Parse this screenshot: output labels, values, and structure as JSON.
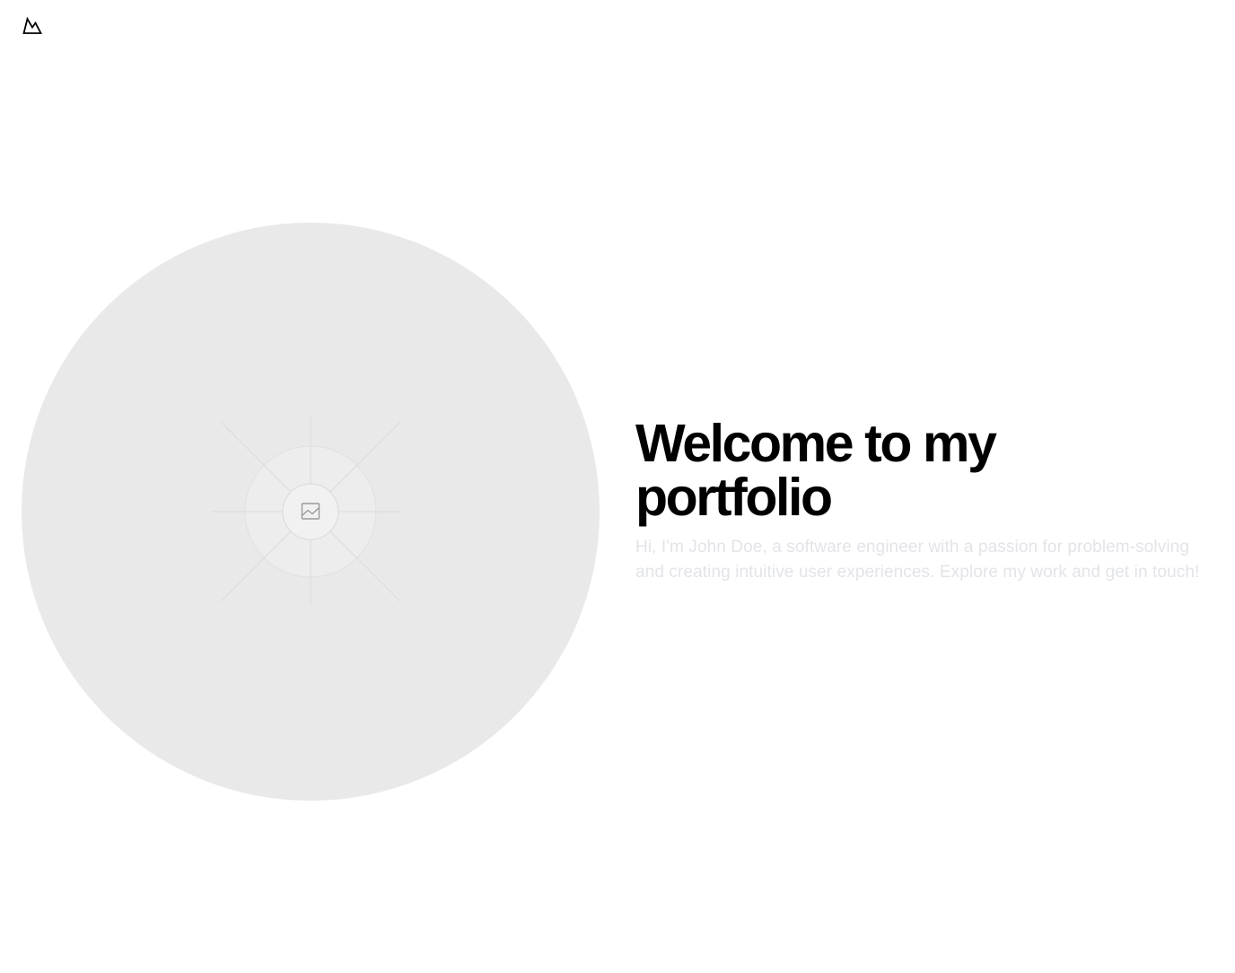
{
  "header": {
    "logo_icon": "mountain-icon"
  },
  "hero": {
    "image_icon": "image-placeholder-icon",
    "image_background": "#e9e9e9",
    "headline": "Welcome to my portfolio",
    "intro": "Hi, I'm John Doe, a software engineer with a passion for problem-solving and creating intuitive user experiences. Explore my work and get in touch!",
    "intro_color": "#e2e4e8",
    "headline_color": "#000000"
  }
}
